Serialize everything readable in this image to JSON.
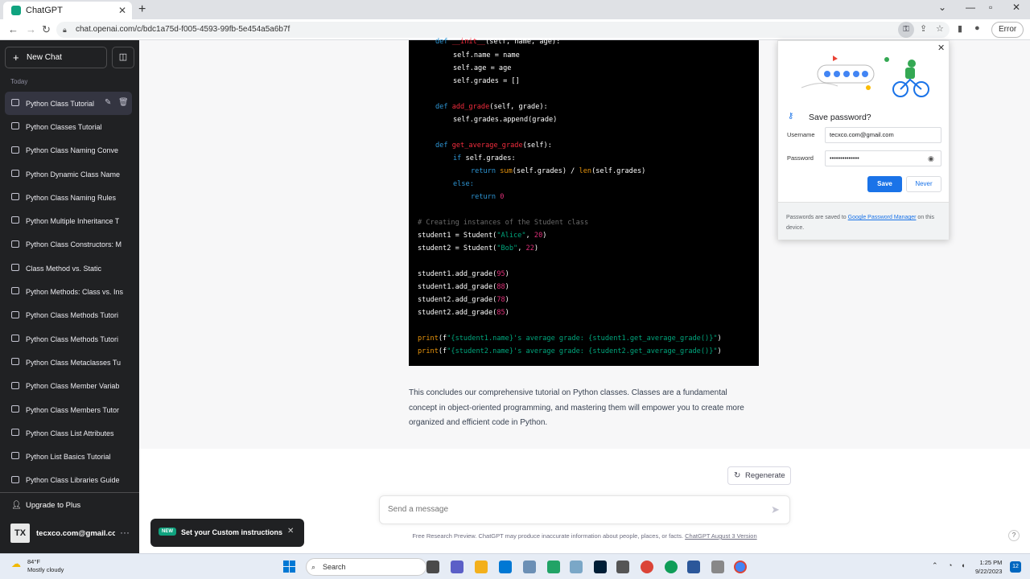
{
  "browser": {
    "tab_title": "ChatGPT",
    "tab_close": "✕",
    "new_tab": "+",
    "url": "chat.openai.com/c/bdc1a75d-f005-4593-99fb-5e454a5a6b7f",
    "error_label": "Error"
  },
  "sidebar": {
    "new_chat_label": "New Chat",
    "section_label": "Today",
    "items": [
      {
        "label": "Python Class Tutorial",
        "active": true
      },
      {
        "label": "Python Classes Tutorial"
      },
      {
        "label": "Python Class Naming Conve"
      },
      {
        "label": "Python Dynamic Class Name"
      },
      {
        "label": "Python Class Naming Rules"
      },
      {
        "label": "Python Multiple Inheritance T"
      },
      {
        "label": "Python Class Constructors: M"
      },
      {
        "label": "Class Method vs. Static"
      },
      {
        "label": "Python Methods: Class vs. Ins"
      },
      {
        "label": "Python Class Methods Tutori"
      },
      {
        "label": "Python Class Methods Tutori"
      },
      {
        "label": "Python Class Metaclasses Tu"
      },
      {
        "label": "Python Class Member Variab"
      },
      {
        "label": "Python Class Members Tutor"
      },
      {
        "label": "Python Class List Attributes"
      },
      {
        "label": "Python List Basics Tutorial"
      },
      {
        "label": "Python Class Libraries Guide"
      }
    ],
    "upgrade_label": "Upgrade to Plus",
    "avatar_text": "TX",
    "account_email": "tecxco.com@gmail.com",
    "more": "···"
  },
  "code": {
    "line1_a": "def ",
    "line1_b": "__init__",
    "line1_c": "(self, name, age):",
    "line2": "self.name = name",
    "line3": "self.age = age",
    "line4": "self.grades = []",
    "line5_a": "def ",
    "line5_b": "add_grade",
    "line5_c": "(self, grade):",
    "line6": "self.grades.append(grade)",
    "line7_a": "def ",
    "line7_b": "get_average_grade",
    "line7_c": "(self):",
    "line8_a": "if ",
    "line8_b": "self.grades:",
    "line9_a": "return ",
    "line9_b": "sum",
    "line9_c": "(self.grades) / ",
    "line9_d": "len",
    "line9_e": "(self.grades)",
    "line10": "else:",
    "line11_a": "return ",
    "line11_b": "0",
    "line12": "# Creating instances of the Student class",
    "line13_a": "student1 = Student(",
    "line13_b": "\"Alice\"",
    "line13_c": ", ",
    "line13_d": "20",
    "line13_e": ")",
    "line14_a": "student2 = Student(",
    "line14_b": "\"Bob\"",
    "line14_c": ", ",
    "line14_d": "22",
    "line14_e": ")",
    "line15_a": "student1.add_grade(",
    "line15_b": "95",
    "line16_a": "student1.add_grade(",
    "line16_b": "88",
    "line17_a": "student2.add_grade(",
    "line17_b": "78",
    "line18_a": "student2.add_grade(",
    "line18_b": "85",
    "close_paren": ")",
    "line19_a": "print",
    "line19_b": "(f",
    "line19_c": "\"{student1.name}'s average grade: {student1.get_average_grade()}\"",
    "line20_a": "print",
    "line20_b": "(f",
    "line20_c": "\"{student2.name}'s average grade: {student2.get_average_grade()}\""
  },
  "conclusion": "This concludes our comprehensive tutorial on Python classes. Classes are a fundamental concept in object-oriented programming, and mastering them will empower you to create more organized and efficient code in Python.",
  "composer": {
    "regenerate_label": "Regenerate",
    "placeholder": "Send a message",
    "disclaimer_text": "Free Research Preview. ChatGPT may produce inaccurate information about people, places, or facts. ",
    "disclaimer_link": "ChatGPT August 3 Version",
    "help": "?"
  },
  "toast": {
    "badge": "NEW",
    "text": "Set your Custom instructions"
  },
  "password_popup": {
    "title": "Save password?",
    "username_label": "Username",
    "username_value": "tecxco.com@gmail.com",
    "password_label": "Password",
    "password_value": "••••••••••••••",
    "save_label": "Save",
    "never_label": "Never",
    "footer_text": "Passwords are saved to ",
    "footer_link": "Google Password Manager",
    "footer_suffix": " on this device."
  },
  "taskbar": {
    "temperature": "84°F",
    "weather": "Mostly cloudy",
    "search_label": "Search",
    "time": "1:25 PM",
    "date": "9/22/2023",
    "notifications": "12"
  }
}
